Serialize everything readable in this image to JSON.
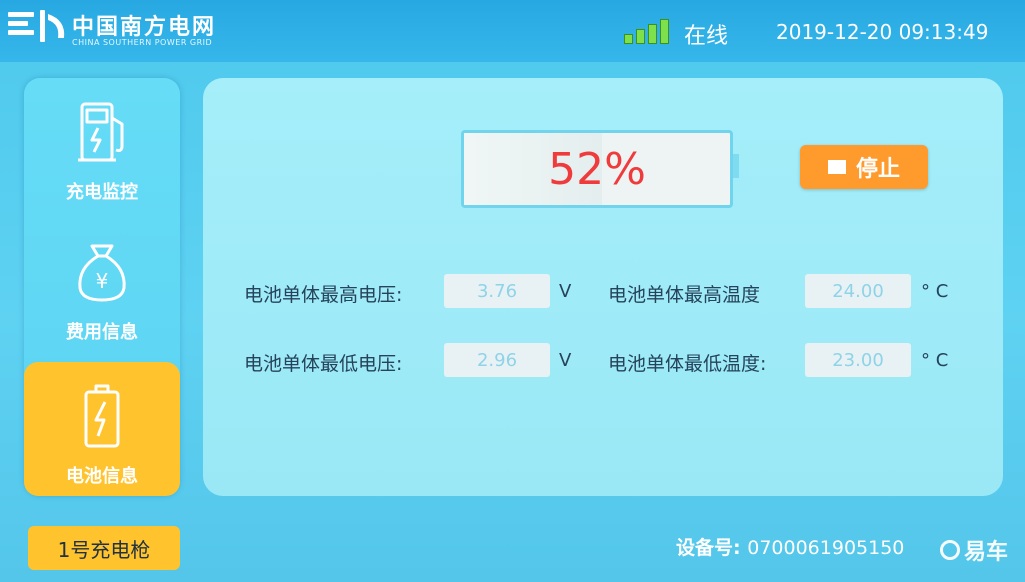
{
  "header": {
    "brand_name": "中国南方电网",
    "brand_sub": "CHINA SOUTHERN POWER GRID",
    "signal_level": 4,
    "status_text": "在线",
    "datetime": "2019-12-20 09:13:49"
  },
  "sidebar": {
    "items": [
      {
        "label": "充电监控",
        "icon": "charging-pump-icon",
        "active": false
      },
      {
        "label": "费用信息",
        "icon": "money-bag-icon",
        "active": false
      },
      {
        "label": "电池信息",
        "icon": "battery-icon",
        "active": true
      }
    ]
  },
  "battery": {
    "percent_text": "52%",
    "percent": 52
  },
  "controls": {
    "stop_label": "停止"
  },
  "fields": {
    "max_voltage": {
      "label": "电池单体最高电压:",
      "value": "3.76",
      "unit": "V"
    },
    "min_voltage": {
      "label": "电池单体最低电压:",
      "value": "2.96",
      "unit": "V"
    },
    "max_temp": {
      "label": "电池单体最高温度",
      "value": "24.00",
      "unit": "° C"
    },
    "min_temp": {
      "label": "电池单体最低温度:",
      "value": "23.00",
      "unit": "° C"
    }
  },
  "footer": {
    "gun_label": "1号充电枪",
    "device_label": "设备号:",
    "device_number": "0700061905150",
    "watermark": "易车"
  },
  "colors": {
    "header_bg": "#27a8e2",
    "accent_yellow": "#ffc32d",
    "stop_orange": "#ff9a2c",
    "battery_text": "#ef3b3b"
  }
}
